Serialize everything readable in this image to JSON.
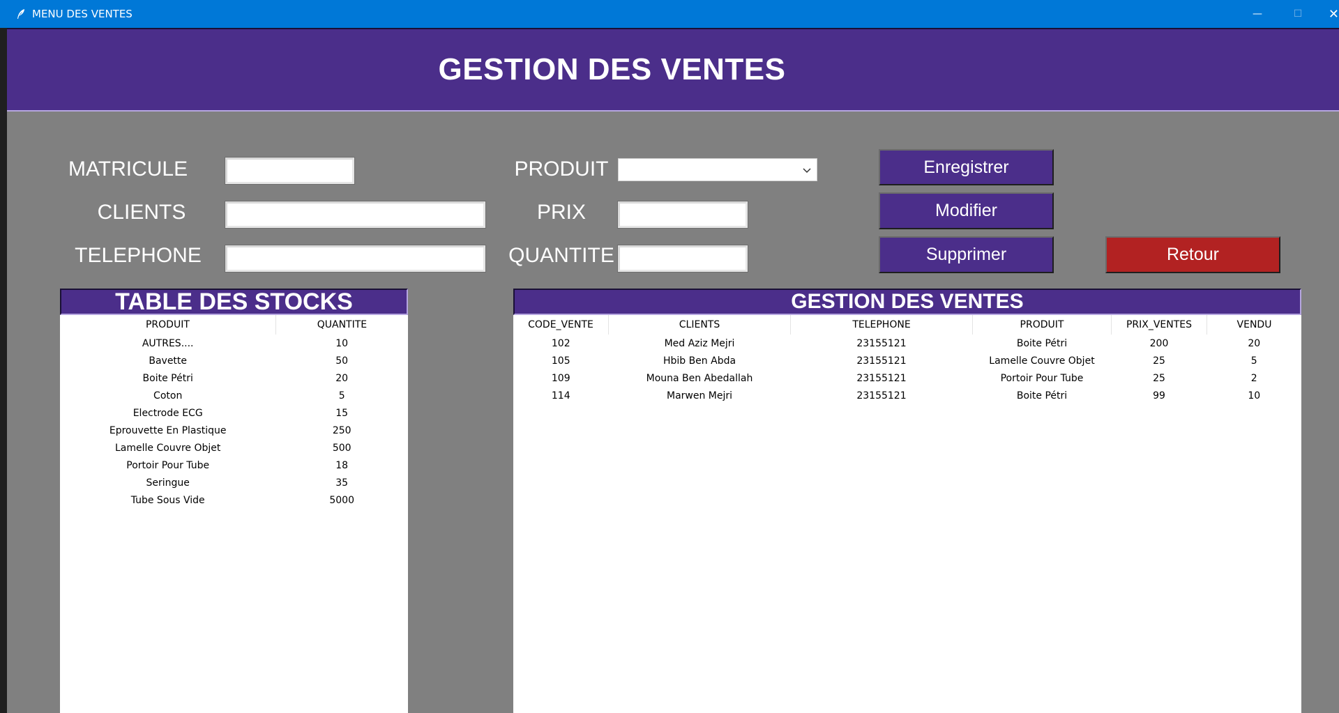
{
  "window": {
    "title": "MENU DES VENTES",
    "controls": {
      "minimize": "—",
      "maximize": "☐",
      "close": "✕"
    }
  },
  "banner": {
    "title": "GESTION DES VENTES"
  },
  "form": {
    "matricule_label": "MATRICULE",
    "clients_label": "CLIENTS",
    "telephone_label": "TELEPHONE",
    "produit_label": "PRODUIT",
    "prix_label": "PRIX",
    "quantite_label": "QUANTITE",
    "matricule_value": "",
    "clients_value": "",
    "telephone_value": "",
    "produit_value": "",
    "prix_value": "",
    "quantite_value": ""
  },
  "buttons": {
    "enregistrer": "Enregistrer",
    "modifier": "Modifier",
    "supprimer": "Supprimer",
    "retour": "Retour"
  },
  "stocks": {
    "title": "TABLE DES STOCKS",
    "columns": [
      "PRODUIT",
      "QUANTITE"
    ],
    "rows": [
      [
        "AUTRES....",
        "10"
      ],
      [
        "Bavette",
        "50"
      ],
      [
        "Boite Pétri",
        "20"
      ],
      [
        "Coton",
        "5"
      ],
      [
        "Electrode ECG",
        "15"
      ],
      [
        "Eprouvette En Plastique",
        "250"
      ],
      [
        "Lamelle Couvre Objet",
        "500"
      ],
      [
        "Portoir Pour Tube",
        "18"
      ],
      [
        "Seringue",
        "35"
      ],
      [
        "Tube Sous Vide",
        "5000"
      ]
    ]
  },
  "ventes": {
    "title": "GESTION DES VENTES",
    "columns": [
      "CODE_VENTE",
      "CLIENTS",
      "TELEPHONE",
      "PRODUIT",
      "PRIX_VENTES",
      "VENDU"
    ],
    "rows": [
      [
        "102",
        "Med Aziz Mejri",
        "23155121",
        "Boite Pétri",
        "200",
        "20"
      ],
      [
        "105",
        "Hbib Ben Abda",
        "23155121",
        "Lamelle Couvre Objet",
        "25",
        "5"
      ],
      [
        "109",
        "Mouna Ben Abedallah",
        "23155121",
        "Portoir Pour Tube",
        "25",
        "2"
      ],
      [
        "114",
        "Marwen Mejri",
        "23155121",
        "Boite Pétri",
        "99",
        "10"
      ]
    ]
  },
  "colors": {
    "titlebar": "#0078d7",
    "accent_purple": "#4b2e8a",
    "retour_red": "#b22222",
    "background_gray": "#808080"
  },
  "icons": {
    "app": "feather-icon",
    "produit_dropdown": "chevron-down-icon"
  }
}
